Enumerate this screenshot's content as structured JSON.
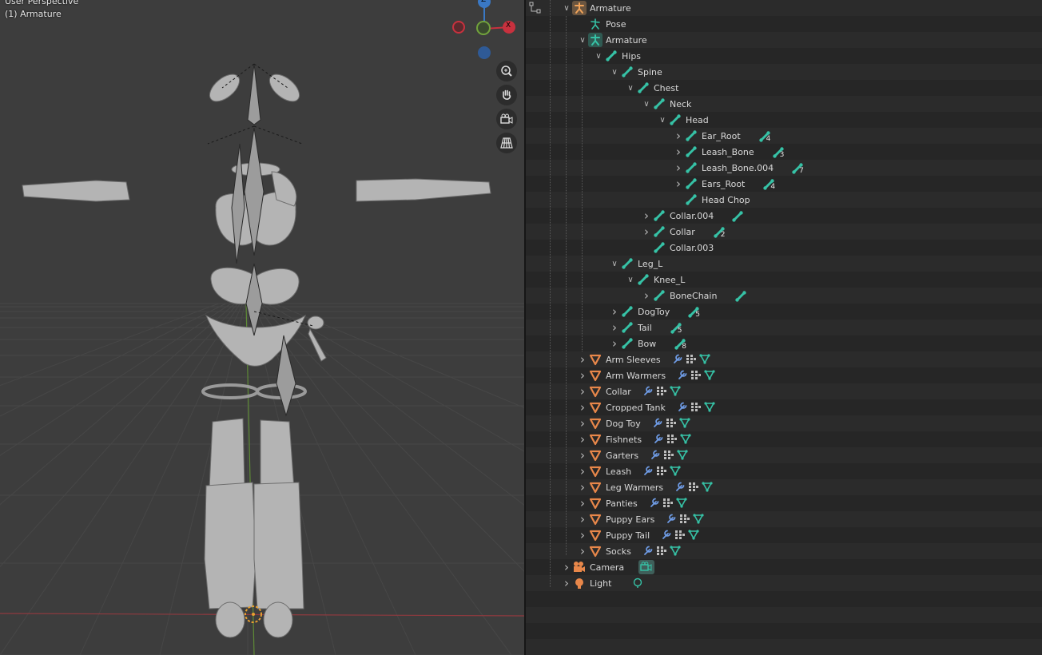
{
  "viewport": {
    "perspective_label": "User Perspective",
    "object_label": "(1) Armature",
    "gizmo": {
      "z_label": "Z",
      "x_label": "X"
    },
    "colors": {
      "x_axis": "#c8313e",
      "y_axis": "#71a23c",
      "z_axis": "#3a78c4",
      "background": "#3d3d3d",
      "grid": "#4a4a4a"
    },
    "nav_icons": [
      "zoom-icon",
      "hand-pan-icon",
      "camera-view-icon",
      "grid-ortho-icon"
    ]
  },
  "outliner": {
    "header_icon": "filter-tree-icon",
    "items": [
      {
        "label": "Armature",
        "level": 0,
        "chevron": "open",
        "icon": "armature-object-icon"
      },
      {
        "label": "Pose",
        "level": 1,
        "chevron": "none",
        "icon": "pose-icon"
      },
      {
        "label": "Armature",
        "level": 1,
        "chevron": "open",
        "icon": "armature-data-icon"
      },
      {
        "label": "Hips",
        "level": 2,
        "chevron": "open",
        "icon": "bone-icon"
      },
      {
        "label": "Spine",
        "level": 3,
        "chevron": "open",
        "icon": "bone-icon"
      },
      {
        "label": "Chest",
        "level": 4,
        "chevron": "open",
        "icon": "bone-icon"
      },
      {
        "label": "Neck",
        "level": 5,
        "chevron": "open",
        "icon": "bone-icon"
      },
      {
        "label": "Head",
        "level": 6,
        "chevron": "open",
        "icon": "bone-icon"
      },
      {
        "label": "Ear_Root",
        "level": 7,
        "chevron": "closed",
        "icon": "bone-icon",
        "child_count": "4"
      },
      {
        "label": "Leash_Bone",
        "level": 7,
        "chevron": "closed",
        "icon": "bone-icon",
        "child_count": "3"
      },
      {
        "label": "Leash_Bone.004",
        "level": 7,
        "chevron": "closed",
        "icon": "bone-icon",
        "child_count": "7"
      },
      {
        "label": "Ears_Root",
        "level": 7,
        "chevron": "closed",
        "icon": "bone-icon",
        "child_count": "4"
      },
      {
        "label": "Head Chop",
        "level": 7,
        "chevron": "none",
        "icon": "bone-icon"
      },
      {
        "label": "Collar.004",
        "level": 5,
        "chevron": "closed",
        "icon": "bone-icon",
        "child_count": ""
      },
      {
        "label": "Collar",
        "level": 5,
        "chevron": "closed",
        "icon": "bone-icon",
        "child_count": "2"
      },
      {
        "label": "Collar.003",
        "level": 5,
        "chevron": "none",
        "icon": "bone-icon"
      },
      {
        "label": "Leg_L",
        "level": 3,
        "chevron": "open",
        "icon": "bone-icon"
      },
      {
        "label": "Knee_L",
        "level": 4,
        "chevron": "open",
        "icon": "bone-icon"
      },
      {
        "label": "BoneChain",
        "level": 5,
        "chevron": "closed",
        "icon": "bone-icon",
        "child_count": ""
      },
      {
        "label": "DogToy",
        "level": 3,
        "chevron": "closed",
        "icon": "bone-icon",
        "child_count": "5"
      },
      {
        "label": "Tail",
        "level": 3,
        "chevron": "closed",
        "icon": "bone-icon",
        "child_count": "5"
      },
      {
        "label": "Bow",
        "level": 3,
        "chevron": "closed",
        "icon": "bone-icon",
        "child_count": "8"
      },
      {
        "label": "Arm Sleeves",
        "level": 1,
        "chevron": "closed",
        "icon": "mesh-object-icon",
        "mesh_extras": true
      },
      {
        "label": "Arm Warmers",
        "level": 1,
        "chevron": "closed",
        "icon": "mesh-object-icon",
        "mesh_extras": true
      },
      {
        "label": "Collar",
        "level": 1,
        "chevron": "closed",
        "icon": "mesh-object-icon",
        "mesh_extras": true
      },
      {
        "label": "Cropped Tank",
        "level": 1,
        "chevron": "closed",
        "icon": "mesh-object-icon",
        "mesh_extras": true
      },
      {
        "label": "Dog Toy",
        "level": 1,
        "chevron": "closed",
        "icon": "mesh-object-icon",
        "mesh_extras": true
      },
      {
        "label": "Fishnets",
        "level": 1,
        "chevron": "closed",
        "icon": "mesh-object-icon",
        "mesh_extras": true
      },
      {
        "label": "Garters",
        "level": 1,
        "chevron": "closed",
        "icon": "mesh-object-icon",
        "mesh_extras": true
      },
      {
        "label": "Leash",
        "level": 1,
        "chevron": "closed",
        "icon": "mesh-object-icon",
        "mesh_extras": true
      },
      {
        "label": "Leg Warmers",
        "level": 1,
        "chevron": "closed",
        "icon": "mesh-object-icon",
        "mesh_extras": true
      },
      {
        "label": "Panties",
        "level": 1,
        "chevron": "closed",
        "icon": "mesh-object-icon",
        "mesh_extras": true
      },
      {
        "label": "Puppy Ears",
        "level": 1,
        "chevron": "closed",
        "icon": "mesh-object-icon",
        "mesh_extras": true
      },
      {
        "label": "Puppy Tail",
        "level": 1,
        "chevron": "closed",
        "icon": "mesh-object-icon",
        "mesh_extras": true
      },
      {
        "label": "Socks",
        "level": 1,
        "chevron": "closed",
        "icon": "mesh-object-icon",
        "mesh_extras": true
      },
      {
        "label": "Camera",
        "level": 0,
        "chevron": "closed",
        "icon": "camera-object-icon",
        "extra_icon": "camera-data-icon"
      },
      {
        "label": "Light",
        "level": 0,
        "chevron": "closed",
        "icon": "light-object-icon",
        "extra_icon": "light-data-icon"
      }
    ],
    "colors": {
      "bone": "#36c2a6",
      "mesh": "#e8874a",
      "wrench": "#6f9ce6",
      "vertex_group": "#bdbdbd",
      "mesh_data": "#36c2a6",
      "text": "#d8d8d8"
    }
  }
}
